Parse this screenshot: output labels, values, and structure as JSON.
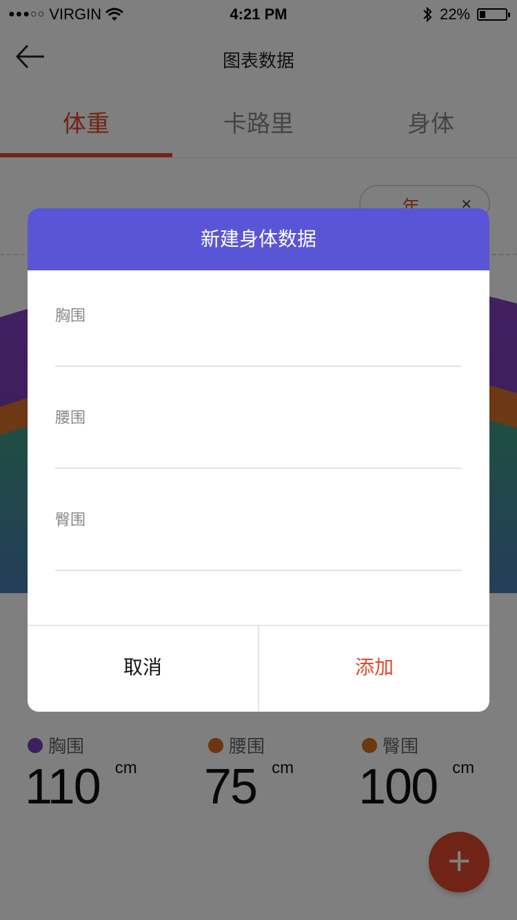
{
  "status_bar": {
    "signal_dots": "●●●○○",
    "carrier": "VIRGIN",
    "time": "4:21 PM",
    "battery": "22%",
    "battery_level": 0.22
  },
  "header": {
    "title": "图表数据",
    "back_icon": "arrow-left-icon"
  },
  "tabs": [
    {
      "label": "体重",
      "active": true
    },
    {
      "label": "卡路里",
      "active": false
    },
    {
      "label": "身体",
      "active": false
    }
  ],
  "period_select": {
    "value": "年"
  },
  "colors": {
    "accent": "#e0492a",
    "dialog_header": "#5a55d6",
    "chest": "#7b3fb8",
    "waist": "#d86a1e",
    "hip": "#d8701e"
  },
  "metrics": [
    {
      "label": "胸围",
      "value": "110",
      "unit": "cm"
    },
    {
      "label": "腰围",
      "value": "75",
      "unit": "cm"
    },
    {
      "label": "臀围",
      "value": "100",
      "unit": "cm"
    }
  ],
  "fab": {
    "label": "+"
  },
  "dialog": {
    "title": "新建身体数据",
    "fields": [
      {
        "label": "胸围",
        "value": ""
      },
      {
        "label": "腰围",
        "value": ""
      },
      {
        "label": "臀围",
        "value": ""
      }
    ],
    "cancel_label": "取消",
    "add_label": "添加"
  }
}
